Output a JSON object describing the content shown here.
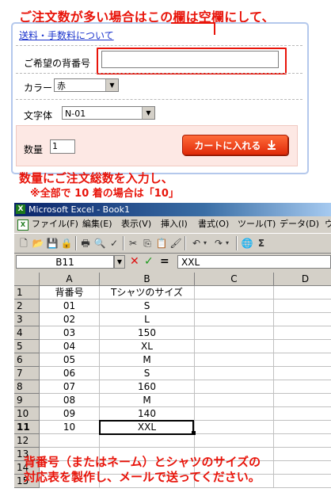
{
  "annotations": {
    "top_note": "ご注文数が多い場合はこの欄は空欄にして、",
    "bottom_note_line1": "数量にご注文総数を入力し、",
    "bottom_note_line2": "※全部で 10 着の場合は「10」",
    "excel_note_line1": "背番号（またはネーム）とシャツのサイズの",
    "excel_note_line2": "対応表を製作し、メールで送ってください。",
    "accent_color": "#e8140a"
  },
  "cart_form": {
    "shipping_link": "送料・手数料について",
    "number_label": "ご希望の背番号",
    "number_value": "",
    "color_label": "カラー",
    "color_value": "赤",
    "font_label": "文字体",
    "font_value": "N-01",
    "qty_label": "数量",
    "qty_value": "1",
    "cart_button": "カートに入れる",
    "cart_icon": "download-arrow-icon"
  },
  "excel": {
    "title": "Microsoft Excel - Book1",
    "menus": [
      "ファイル(F)",
      "編集(E)",
      "表示(V)",
      "挿入(I)",
      "書式(O)",
      "ツール(T)",
      "データ(D)",
      "ウ"
    ],
    "name_box": "B11",
    "formula_value": "XXL",
    "column_headers": [
      "A",
      "B",
      "C",
      "D"
    ],
    "row_numbers": [
      "1",
      "2",
      "3",
      "4",
      "5",
      "6",
      "7",
      "8",
      "9",
      "10",
      "11",
      "12",
      "13",
      "14",
      "15"
    ],
    "rows": [
      [
        "背番号",
        "Tシャツのサイズ"
      ],
      [
        "01",
        "S"
      ],
      [
        "02",
        "L"
      ],
      [
        "03",
        "150"
      ],
      [
        "04",
        "XL"
      ],
      [
        "05",
        "M"
      ],
      [
        "06",
        "S"
      ],
      [
        "07",
        "160"
      ],
      [
        "08",
        "M"
      ],
      [
        "09",
        "140"
      ],
      [
        "10",
        "XXL"
      ]
    ],
    "active_row": "11"
  }
}
